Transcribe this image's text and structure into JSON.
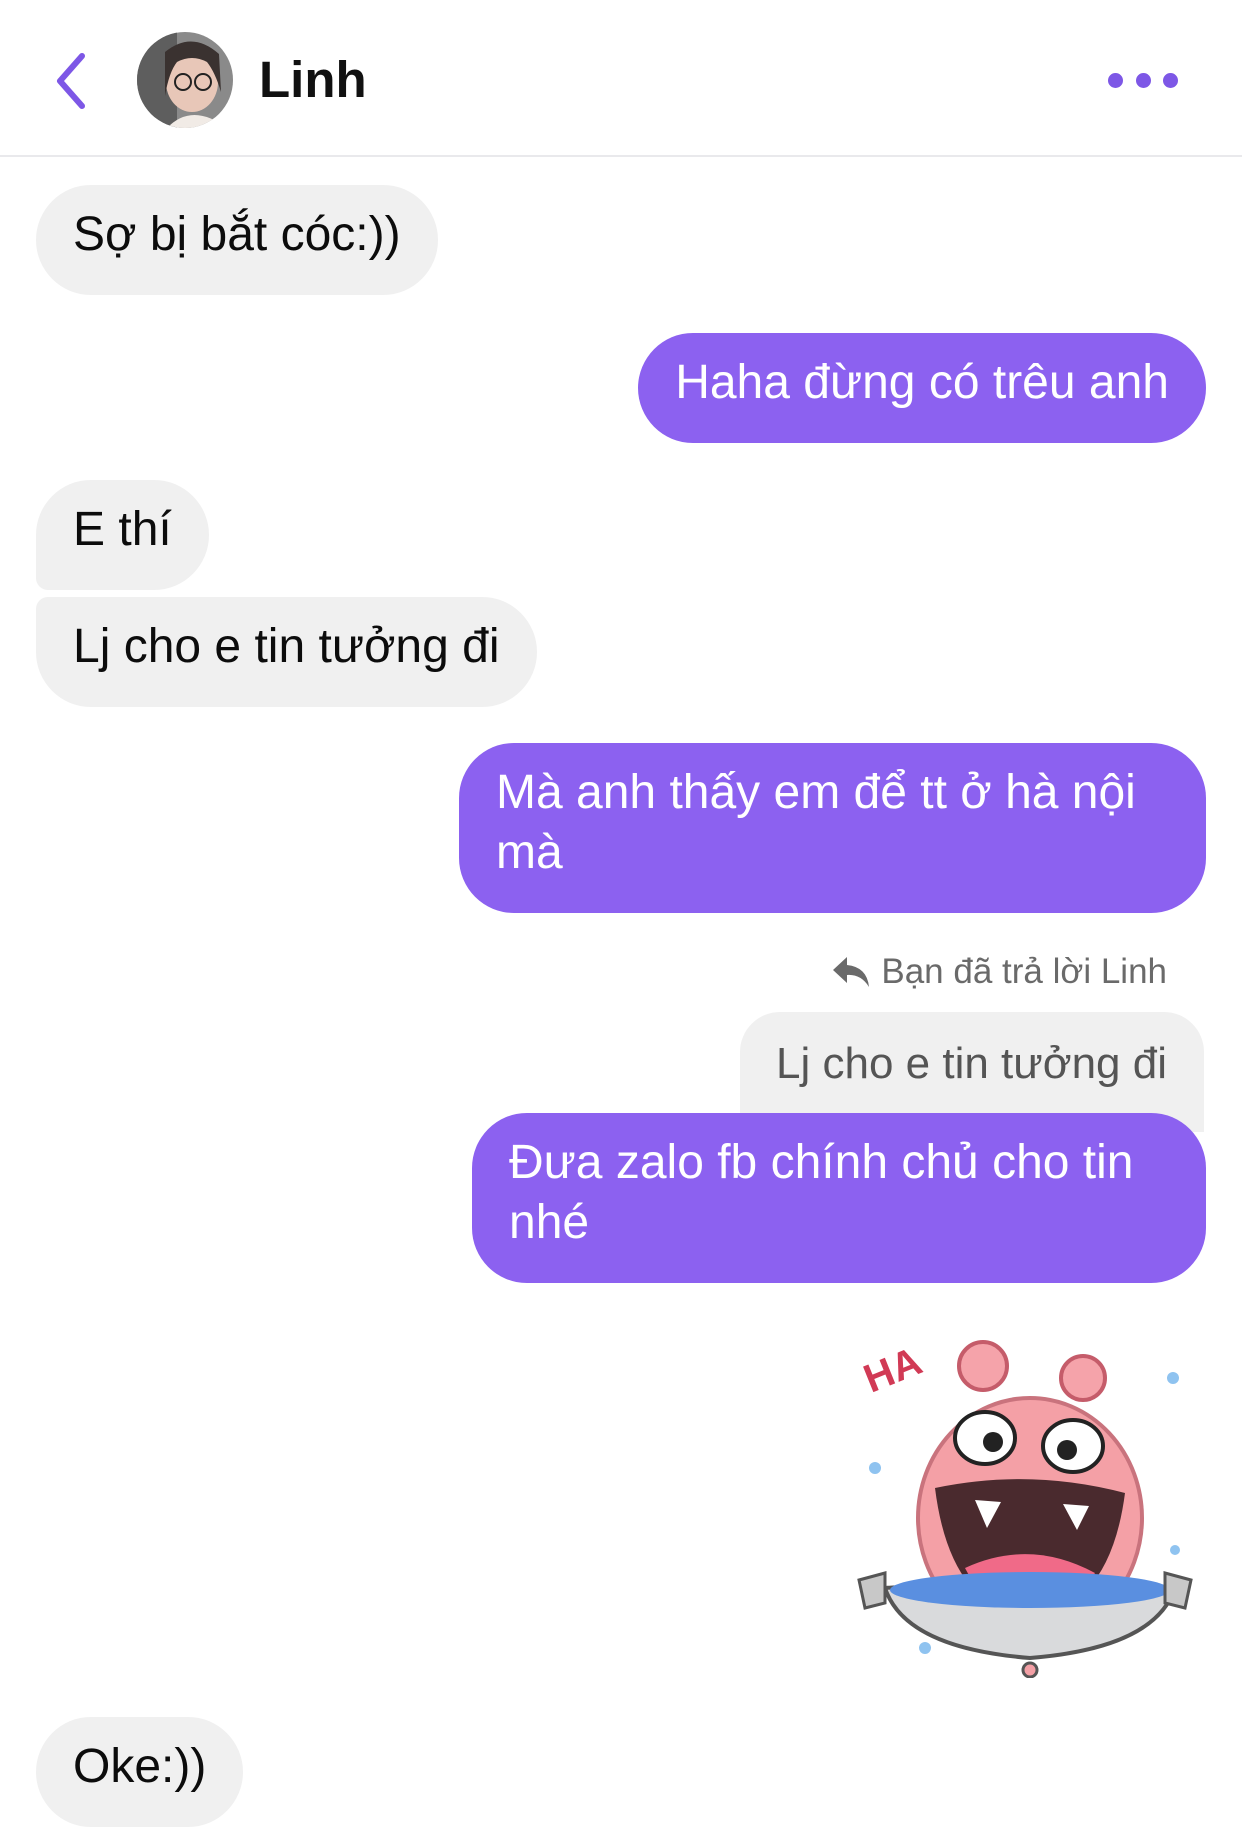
{
  "header": {
    "back_icon": "chevron-left-icon",
    "contact_name": "Linh",
    "more_icon": "more-horizontal-icon",
    "accent_color": "#8c61f0"
  },
  "messages": [
    {
      "side": "in",
      "text": "Sợ bị bắt cóc:))"
    },
    {
      "side": "out",
      "text": "Haha đừng có trêu anh"
    },
    {
      "side": "in",
      "text": "E thí"
    },
    {
      "side": "in",
      "text": "Lj cho e tin tưởng đi"
    },
    {
      "side": "out",
      "text": "Mà anh thấy em để tt ở hà nội mà"
    },
    {
      "side": "out",
      "text": "Đưa zalo fb chính chủ cho tin nhé",
      "reply": {
        "note": "Bạn đã trả lời Linh",
        "quoted_text": "Lj cho e tin tưởng đi"
      }
    },
    {
      "side": "out",
      "type": "sticker",
      "sticker_icon": "laughing-pink-blob-sticker",
      "sticker_text": "HA"
    },
    {
      "side": "in",
      "text": "Oke:))"
    }
  ],
  "colors": {
    "incoming_bubble": "#f0f0f0",
    "outgoing_bubble": "#8c61f0"
  }
}
